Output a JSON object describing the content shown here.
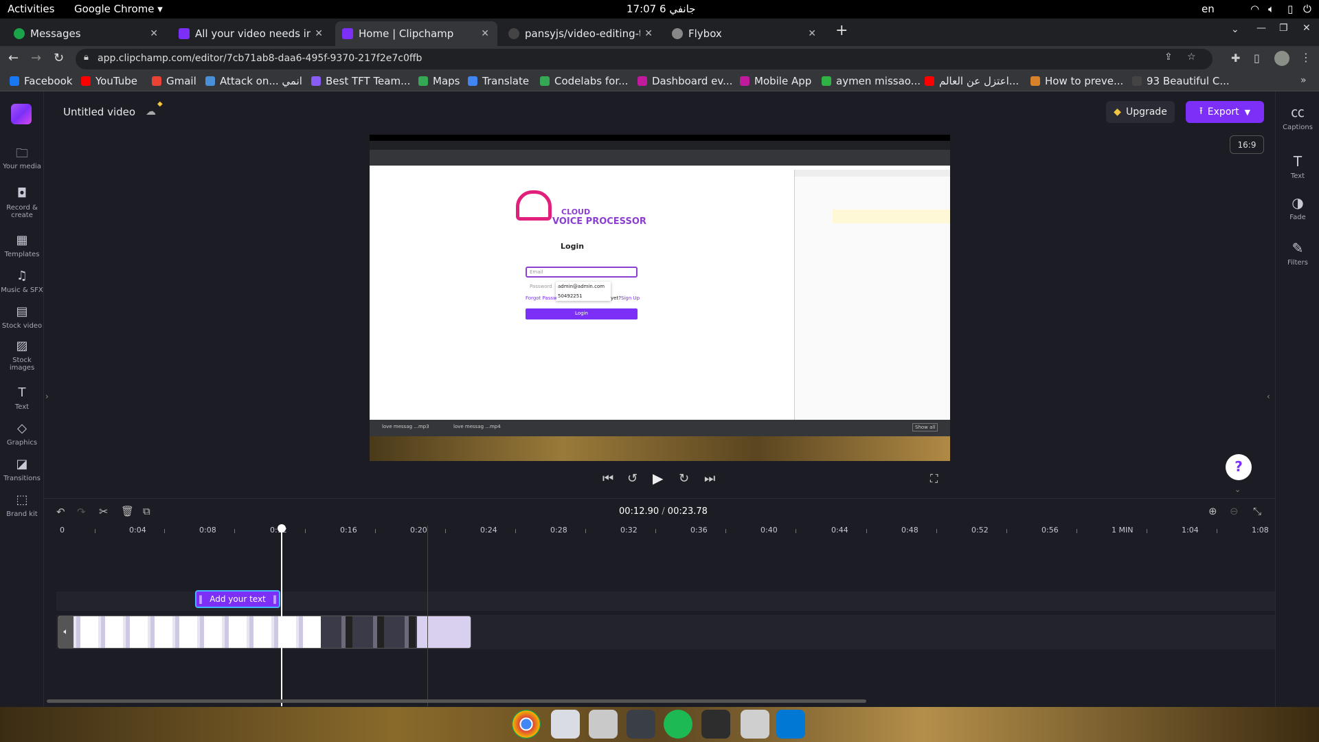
{
  "gnome": {
    "activities": "Activities",
    "app": "Google Chrome",
    "clock": "17:07  6 جانفي",
    "lang": "en"
  },
  "tabs": [
    {
      "title": "Messages",
      "color": "#1aa34a"
    },
    {
      "title": "All your video needs in on",
      "color": "#7b2ff7"
    },
    {
      "title": "Home | Clipchamp",
      "color": "#7b2ff7"
    },
    {
      "title": "pansyjs/video-editing-tim",
      "color": "#444"
    },
    {
      "title": "Flybox",
      "color": "#888"
    }
  ],
  "address": {
    "url": "app.clipchamp.com/editor/7cb71ab8-daa6-495f-9370-217f2e7c0ffb"
  },
  "bookmarks": [
    {
      "label": "Facebook",
      "color": "#1877f2"
    },
    {
      "label": "YouTube",
      "color": "#ff0000"
    },
    {
      "label": "Gmail",
      "color": "#ea4335"
    },
    {
      "label": "Attack on... انمي",
      "color": "#4a90d9"
    },
    {
      "label": "Best TFT Team...",
      "color": "#8a5cf6"
    },
    {
      "label": "Maps",
      "color": "#34a853"
    },
    {
      "label": "Translate",
      "color": "#4285f4"
    },
    {
      "label": "Codelabs for...",
      "color": "#34a853"
    },
    {
      "label": "Dashboard ev...",
      "color": "#c21a9d"
    },
    {
      "label": "Mobile App",
      "color": "#c21a9d"
    },
    {
      "label": "aymen missao...",
      "color": "#2fb344"
    },
    {
      "label": "اعتزل عن العالم...",
      "color": "#ff0000"
    },
    {
      "label": "How to preve...",
      "color": "#d9822b"
    },
    {
      "label": "93 Beautiful C...",
      "color": "#333"
    }
  ],
  "editor": {
    "project_title": "Untitled video",
    "upgrade": "Upgrade",
    "export": "Export",
    "aspect": "16:9",
    "time_current": "00:12.90",
    "time_sep": " / ",
    "time_total": "00:23.78",
    "text_clip": "Add your text",
    "help": "?"
  },
  "left_rail": [
    {
      "label": "Your media",
      "icon": "folder-icon",
      "glyph": "🗀"
    },
    {
      "label": "Record & create",
      "icon": "camera-icon",
      "glyph": "▭"
    },
    {
      "label": "Templates",
      "icon": "templates-icon",
      "glyph": "▦"
    },
    {
      "label": "Music & SFX",
      "icon": "music-icon",
      "glyph": "♫"
    },
    {
      "label": "Stock video",
      "icon": "film-icon",
      "glyph": "▤"
    },
    {
      "label": "Stock images",
      "icon": "image-icon",
      "glyph": "▨"
    },
    {
      "label": "Text",
      "icon": "text-icon",
      "glyph": "T"
    },
    {
      "label": "Graphics",
      "icon": "graphics-icon",
      "glyph": "◇"
    },
    {
      "label": "Transitions",
      "icon": "transitions-icon",
      "glyph": "◪"
    },
    {
      "label": "Brand kit",
      "icon": "brand-kit-icon",
      "glyph": "⬚"
    }
  ],
  "right_rail": [
    {
      "label": "Captions",
      "icon": "captions-icon",
      "glyph": "㏄"
    },
    {
      "label": "Text",
      "icon": "text-icon",
      "glyph": "T"
    },
    {
      "label": "Fade",
      "icon": "fade-icon",
      "glyph": "◑"
    },
    {
      "label": "Filters",
      "icon": "filters-icon",
      "glyph": "✎"
    }
  ],
  "ruler": [
    "0",
    "0:04",
    "0:08",
    "0:12",
    "0:16",
    "0:20",
    "0:24",
    "0:28",
    "0:32",
    "0:36",
    "0:40",
    "0:44",
    "0:48",
    "0:52",
    "0:56",
    "1 MIN",
    "1:04",
    "1:08"
  ],
  "preview": {
    "brand_top": "CLOUD",
    "brand": "VOICE PROCESSOR",
    "login_title": "Login",
    "email_ph": "Email",
    "password_ph": "Password",
    "autofill_1": "admin@admin.com",
    "autofill_2": "50492251",
    "forgot": "Forgot Passw",
    "signup_pre": "yet?",
    "signup": "Sign Up",
    "login_btn": "Login",
    "show_all": "Show all",
    "dl1": "love messag ...mp3",
    "dl2": "love messag ...mp4"
  }
}
